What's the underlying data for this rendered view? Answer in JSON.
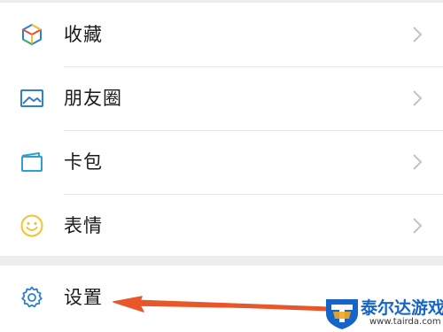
{
  "menu": {
    "favorites": {
      "label": "收藏",
      "icon": "cube-icon"
    },
    "moments": {
      "label": "朋友圈",
      "icon": "image-icon"
    },
    "cards": {
      "label": "卡包",
      "icon": "card-wallet-icon"
    },
    "stickers": {
      "label": "表情",
      "icon": "smiley-icon"
    },
    "settings": {
      "label": "设置",
      "icon": "gear-icon"
    }
  },
  "annotation": {
    "arrow_color": "#e8572a",
    "points_to": "settings"
  },
  "watermark": {
    "text": "泰尔达游戏网",
    "url": "www.tairda.com"
  },
  "colors": {
    "chevron": "#c2c2c2",
    "icon_blue": "#2f7fd0",
    "icon_yellow": "#f3c431"
  }
}
